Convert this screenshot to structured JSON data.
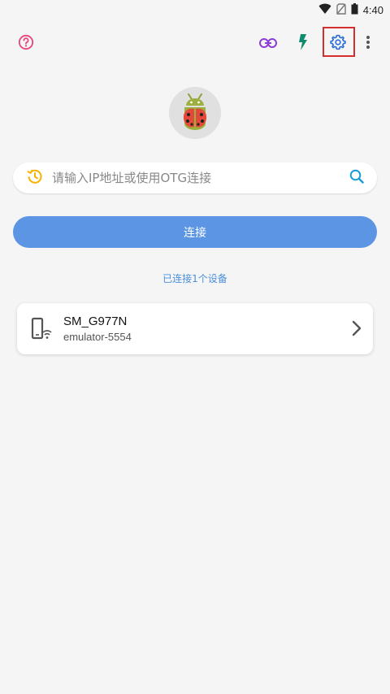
{
  "status_bar": {
    "time": "4:40",
    "icons": [
      "wifi-icon",
      "no-sim-icon",
      "battery-icon"
    ]
  },
  "toolbar": {
    "left": [
      "help-icon"
    ],
    "right": [
      "link-icon",
      "flash-icon",
      "settings-icon",
      "more-vert-icon"
    ],
    "highlighted": "settings-icon",
    "colors": {
      "help": "#e8457a",
      "link": "#8e3bd6",
      "flash": "#0f8a6e",
      "settings": "#2a6fdc",
      "more": "#555555",
      "highlight": "#d32f2f"
    }
  },
  "avatar": {
    "icon": "ladybug-android-icon"
  },
  "search": {
    "placeholder": "请输入IP地址或使用OTG连接",
    "value": "",
    "left_icon": "history-icon",
    "right_icon": "search-icon",
    "colors": {
      "history": "#f5b400",
      "search": "#1a9ad6"
    }
  },
  "connect_button": {
    "label": "连接",
    "color": "#5b95e3"
  },
  "connected_status": "已连接1个设备",
  "devices": [
    {
      "name": "SM_G977N",
      "serial": "emulator-5554",
      "icon": "phone-wifi-icon"
    }
  ]
}
